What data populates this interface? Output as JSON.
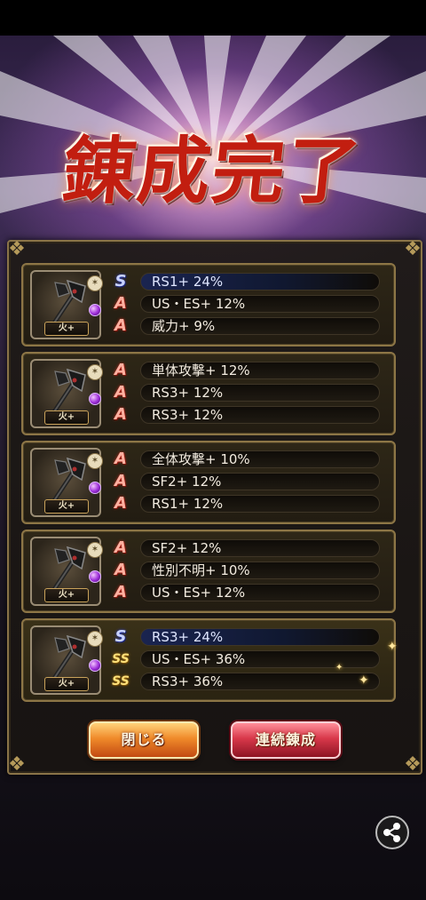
{
  "title": "錬成完了",
  "cards": [
    {
      "badge": "火+",
      "lines": [
        {
          "rank": "S",
          "rank_glyph": "S",
          "text": "RS1+ 24%"
        },
        {
          "rank": "A",
          "rank_glyph": "A",
          "text": "US・ES+ 12%"
        },
        {
          "rank": "A",
          "rank_glyph": "A",
          "text": "威力+ 9%"
        }
      ]
    },
    {
      "badge": "火+",
      "lines": [
        {
          "rank": "A",
          "rank_glyph": "A",
          "text": "単体攻撃+ 12%"
        },
        {
          "rank": "A",
          "rank_glyph": "A",
          "text": "RS3+ 12%"
        },
        {
          "rank": "A",
          "rank_glyph": "A",
          "text": "RS3+ 12%"
        }
      ]
    },
    {
      "badge": "火+",
      "lines": [
        {
          "rank": "A",
          "rank_glyph": "A",
          "text": "全体攻撃+ 10%"
        },
        {
          "rank": "A",
          "rank_glyph": "A",
          "text": "SF2+ 12%"
        },
        {
          "rank": "A",
          "rank_glyph": "A",
          "text": "RS1+ 12%"
        }
      ]
    },
    {
      "badge": "火+",
      "lines": [
        {
          "rank": "A",
          "rank_glyph": "A",
          "text": "SF2+ 12%"
        },
        {
          "rank": "A",
          "rank_glyph": "A",
          "text": "性別不明+ 10%"
        },
        {
          "rank": "A",
          "rank_glyph": "A",
          "text": "US・ES+ 12%"
        }
      ]
    },
    {
      "badge": "火+",
      "lines": [
        {
          "rank": "S",
          "rank_glyph": "S",
          "text": "RS3+ 24%"
        },
        {
          "rank": "SS",
          "rank_glyph": "SS",
          "text": "US・ES+ 36%"
        },
        {
          "rank": "SS",
          "rank_glyph": "SS",
          "text": "RS3+ 36%"
        }
      ]
    }
  ],
  "buttons": {
    "close": "閉じる",
    "continue": "連続錬成"
  },
  "icons": {
    "share": "share-icon",
    "weapon": "axe-weapon-icon",
    "gem": "purple-gem-icon"
  },
  "colors": {
    "title": "#c21e10",
    "panel_border": "#8a7448",
    "close_button": "#f08a2a",
    "continue_button": "#d8384a"
  }
}
